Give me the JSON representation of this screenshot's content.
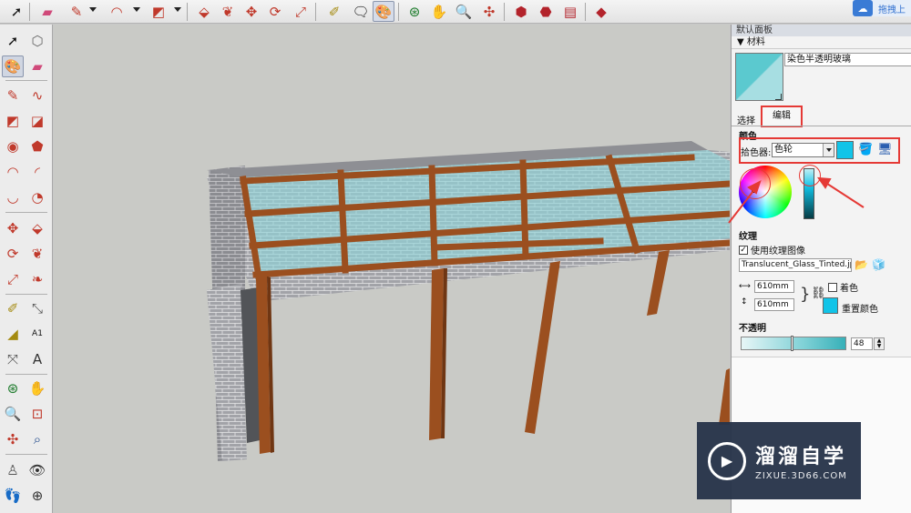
{
  "toolbar": {
    "tools": [
      "select-tool",
      "eraser-tool",
      "line-tool",
      "arc-tool",
      "rectangle-tool",
      "push-pull-tool",
      "follow-me-tool",
      "move-tool",
      "rotate-tool",
      "scale-tool",
      "tape-measure-tool",
      "text-tool",
      "paint-bucket-tool",
      "orbit-tool",
      "pan-tool",
      "zoom-tool",
      "zoom-extents-tool",
      "3d-warehouse",
      "extension-warehouse",
      "send-to-layout",
      "ruby-gem"
    ],
    "cloud_label": "拖拽上"
  },
  "panel": {
    "title": "默认面板",
    "materials_header": "▼ 材料",
    "material_name": "染色半透明玻璃",
    "tab_select": "选择",
    "tab_edit": "编辑",
    "color_section": "颜色",
    "picker_label": "拾色器:",
    "picker_value": "色轮",
    "current_color": "#11c4e8",
    "texture_section": "纹理",
    "use_texture_label": "使用纹理图像",
    "use_texture_checked": true,
    "texture_file": "Translucent_Glass_Tinted.jpg",
    "width_value": "610mm",
    "height_value": "610mm",
    "colorize_label": "着色",
    "colorize_checked": false,
    "reset_color_label": "重置颜色",
    "opacity_section": "不透明",
    "opacity_value": "48",
    "opacity_level": 0.48
  },
  "watermark": {
    "main": "溜溜自学",
    "sub": "ZIXUE.3D66.COM"
  },
  "colors": {
    "wood": "#9b4f1f",
    "glass": "#8fd3d8",
    "brick": "#9a9ba0",
    "highlight": "#e53935"
  }
}
